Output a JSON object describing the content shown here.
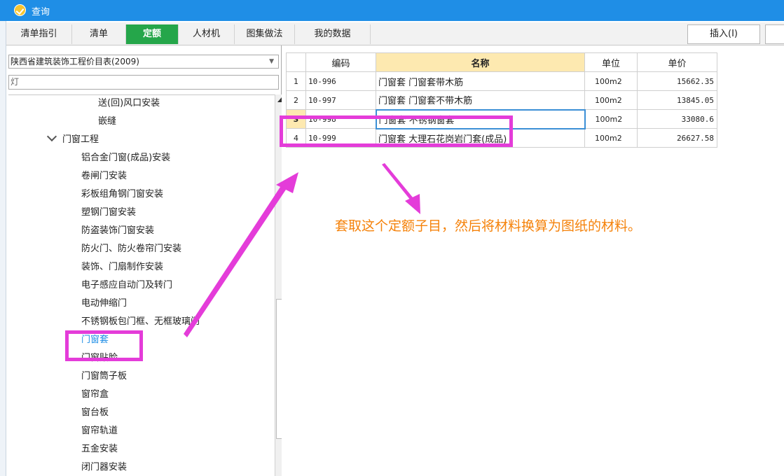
{
  "window": {
    "title": "查询"
  },
  "tabs": [
    {
      "label": "清单指引",
      "active": false
    },
    {
      "label": "清单",
      "active": false
    },
    {
      "label": "定额",
      "active": true
    },
    {
      "label": "人材机",
      "active": false
    },
    {
      "label": "图集做法",
      "active": false
    },
    {
      "label": "我的数据",
      "active": false
    }
  ],
  "toolbar": {
    "insert_label": "插入(I)"
  },
  "library": {
    "selected": "陕西省建筑装饰工程价目表(2009)"
  },
  "search": {
    "value": "灯"
  },
  "tree": {
    "items": [
      {
        "label": "送(回)风口安装"
      },
      {
        "label": "嵌缝"
      },
      {
        "label": "门窗工程"
      },
      {
        "label": "铝合金门窗(成品)安装"
      },
      {
        "label": "卷闸门安装"
      },
      {
        "label": "彩板组角钢门窗安装"
      },
      {
        "label": "塑钢门窗安装"
      },
      {
        "label": "防盗装饰门窗安装"
      },
      {
        "label": "防火门、防火卷帘门安装"
      },
      {
        "label": "装饰、门扇制作安装"
      },
      {
        "label": "电子感应自动门及转门"
      },
      {
        "label": "电动伸缩门"
      },
      {
        "label": "不锈钢板包门框、无框玻璃门"
      },
      {
        "label": "门窗套"
      },
      {
        "label": "门窗贴脸"
      },
      {
        "label": "门窗筒子板"
      },
      {
        "label": "窗帘盒"
      },
      {
        "label": "窗台板"
      },
      {
        "label": "窗帘轨道"
      },
      {
        "label": "五金安装"
      },
      {
        "label": "闭门器安装"
      }
    ],
    "selected_color": "#1f8ee6"
  },
  "grid": {
    "headers": {
      "code": "编码",
      "name": "名称",
      "unit": "单位",
      "price": "单价"
    },
    "rows": [
      {
        "num": "1",
        "code": "10-996",
        "name": "门窗套 门窗套带木筋",
        "unit": "100m2",
        "price": "15662.35"
      },
      {
        "num": "2",
        "code": "10-997",
        "name": "门窗套 门窗套不带木筋",
        "unit": "100m2",
        "price": "13845.05"
      },
      {
        "num": "3",
        "code": "10-998",
        "name": "门窗套 不锈钢窗套",
        "unit": "100m2",
        "price": "33080.6"
      },
      {
        "num": "4",
        "code": "10-999",
        "name": "门窗套 大理石花岗岩门套(成品)",
        "unit": "100m2",
        "price": "26627.58"
      }
    ],
    "selected_row": 3
  },
  "annotation": {
    "text": "套取这个定额子目，然后将材料换算为图纸的材料。",
    "color": "#e43cd9",
    "text_color": "#f5820a"
  }
}
